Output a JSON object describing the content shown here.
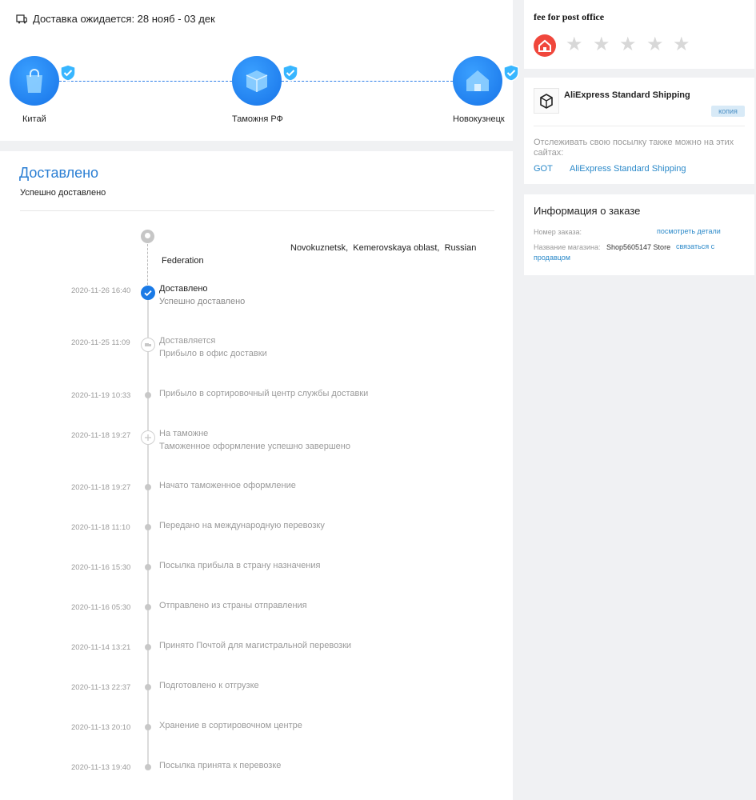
{
  "delivery": {
    "eta_text": "Доставка ожидается: 28 нояб - 03 дек",
    "nodes": [
      "Китай",
      "Таможня РФ",
      "Новокузнецк"
    ]
  },
  "tracking": {
    "status_title": "Доставлено",
    "status_sub": "Успешно доставлено",
    "address_line1": "Novokuznetsk,  Kemerovskaya oblast,  Russian",
    "address_line2": "Federation",
    "events": [
      {
        "time": "2020-11-26 16:40",
        "title": "Доставлено",
        "sub": "Успешно доставлено"
      },
      {
        "time": "2020-11-25 11:09",
        "title": "Доставляется",
        "sub": "Прибыло в офис доставки"
      },
      {
        "time": "2020-11-19 10:33",
        "title": "Прибыло в сортировочный центр службы доставки",
        "sub": ""
      },
      {
        "time": "2020-11-18 19:27",
        "title": "На таможне",
        "sub": "Таможенное оформление успешно завершено"
      },
      {
        "time": "2020-11-18 19:27",
        "title": "Начато таможенное оформление",
        "sub": ""
      },
      {
        "time": "2020-11-18 11:10",
        "title": "Передано на международную перевозку",
        "sub": ""
      },
      {
        "time": "2020-11-16 15:30",
        "title": "Посылка прибыла в страну назначения",
        "sub": ""
      },
      {
        "time": "2020-11-16 05:30",
        "title": "Отправлено из страны отправления",
        "sub": ""
      },
      {
        "time": "2020-11-14 13:21",
        "title": "Принято Почтой для магистральной перевозки",
        "sub": ""
      },
      {
        "time": "2020-11-13 22:37",
        "title": "Подготовлено к отгрузке",
        "sub": ""
      },
      {
        "time": "2020-11-13 20:10",
        "title": "Хранение в сортировочном центре",
        "sub": ""
      },
      {
        "time": "2020-11-13 19:40",
        "title": "Посылка принята к перевозке",
        "sub": ""
      }
    ]
  },
  "rating": {
    "title": "fee for post office",
    "stars_filled": 0,
    "stars_total": 5,
    "icons": [
      "store-icon",
      "star-icon"
    ]
  },
  "shipping": {
    "name": "AliExpress Standard Shipping",
    "copy_label": "копия",
    "track_note": "Отслеживать свою посылку также можно на этих сайтах:",
    "links": [
      "GOT",
      "AliExpress Standard Shipping"
    ]
  },
  "order": {
    "title": "Информация о заказе",
    "order_number_label": "Номер заказа:",
    "view_details": "посмотреть детали",
    "store_label": "Название магазина:",
    "store_name": "Shop5605147 Store",
    "contact_seller_1": "связаться с",
    "contact_seller_2": "продавцом"
  },
  "colors": {
    "accent": "#2b7fd4",
    "node_blue": "#1a7ae6",
    "store_red": "#f0473c",
    "link": "#2b89c9"
  }
}
